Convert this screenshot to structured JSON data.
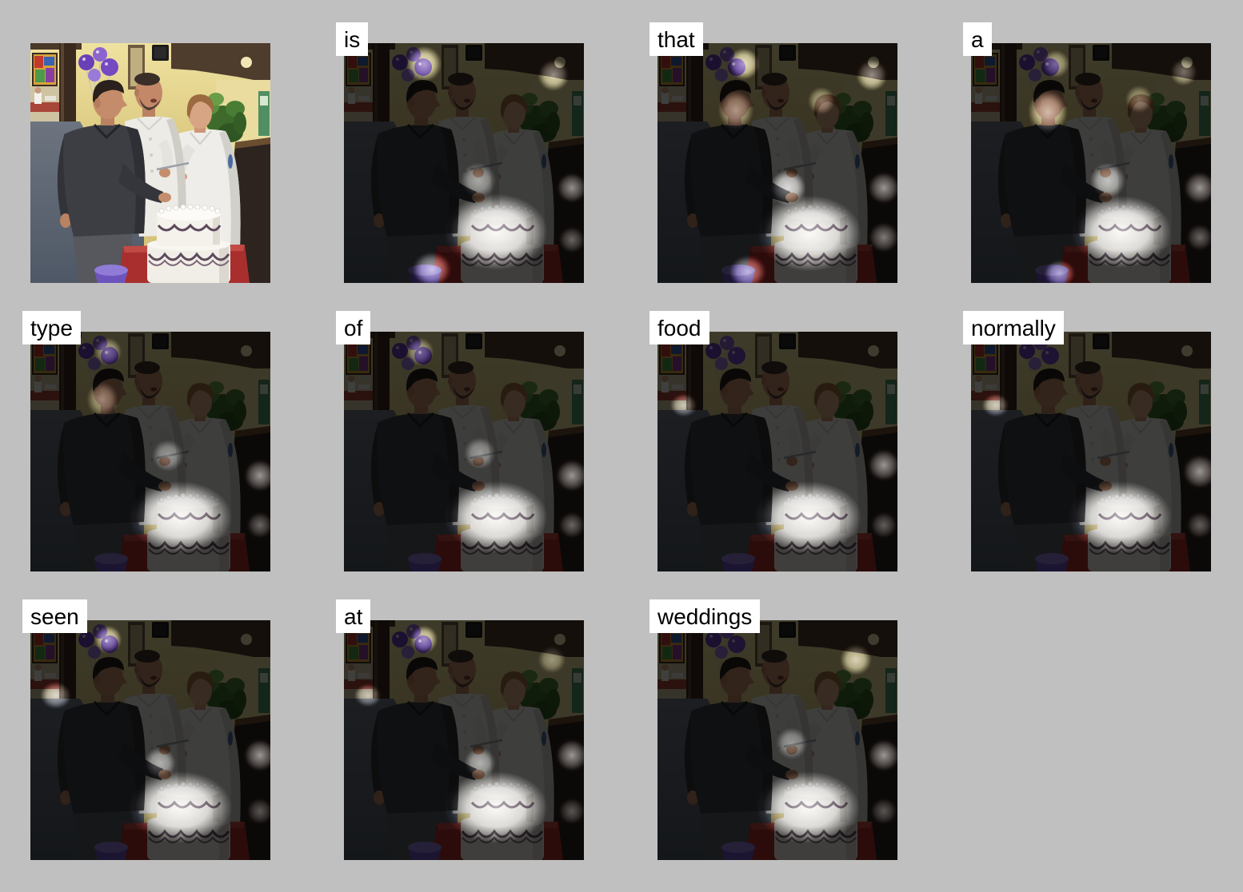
{
  "page": {
    "background_color": "#c0c0c0"
  },
  "label_style": {
    "background_color": "#ffffff",
    "text_color": "#000000"
  },
  "words": [
    "is",
    "that",
    "a",
    "type",
    "of",
    "food",
    "normally",
    "seen",
    "at",
    "weddings"
  ]
}
